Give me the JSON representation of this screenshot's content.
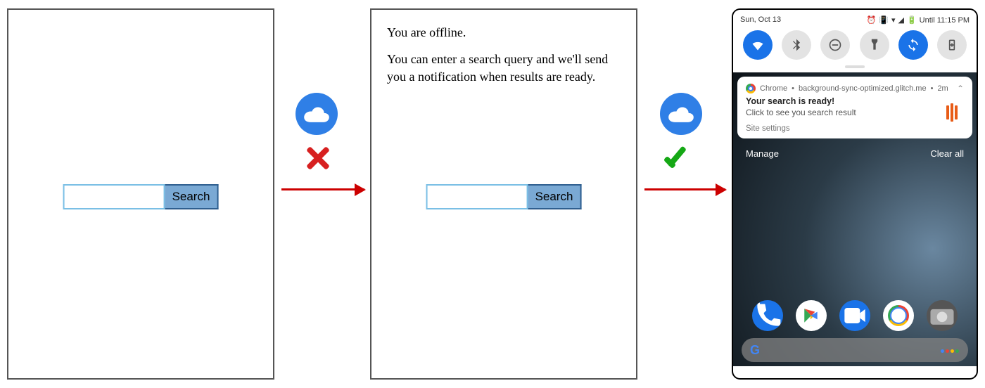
{
  "panel1": {
    "search_button": "Search"
  },
  "offline": {
    "title": "You are offline.",
    "message": "You can enter a search query and we'll send you a notification when results are ready."
  },
  "panel2": {
    "search_button": "Search"
  },
  "transitions": {
    "first_state": "offline",
    "second_state": "online"
  },
  "phone": {
    "status_date": "Sun, Oct 13",
    "status_right": "Until 11:15 PM",
    "qs": {
      "wifi": "on",
      "bluetooth": "off",
      "dnd": "off",
      "flashlight": "off",
      "rotate": "on",
      "battery_saver": "off"
    },
    "notification": {
      "source": "Chrome",
      "site": "background-sync-optimized.glitch.me",
      "age": "2m",
      "title": "Your search is ready!",
      "body": "Click to see you search result",
      "site_settings": "Site settings"
    },
    "manage": "Manage",
    "clear_all": "Clear all"
  }
}
